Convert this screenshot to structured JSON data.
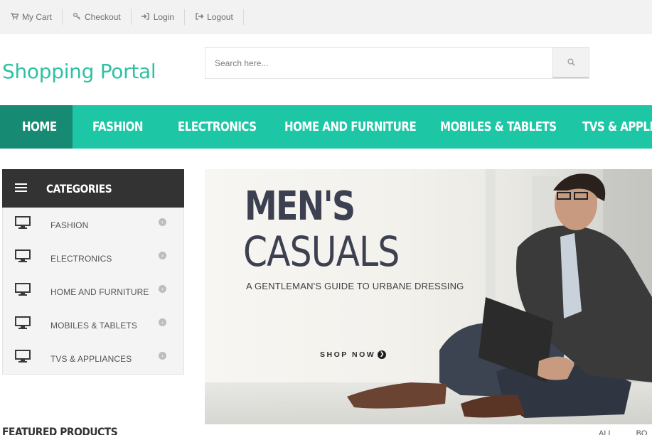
{
  "topbar": {
    "links": [
      {
        "label": "My Cart",
        "icon": "cart-icon"
      },
      {
        "label": "Checkout",
        "icon": "key-icon"
      },
      {
        "label": "Login",
        "icon": "sign-in-icon"
      },
      {
        "label": "Logout",
        "icon": "sign-out-icon"
      }
    ]
  },
  "header": {
    "logo": "Shopping Portal",
    "search_placeholder": "Search here..."
  },
  "nav": {
    "items": [
      {
        "label": "HOME",
        "active": true
      },
      {
        "label": "FASHION"
      },
      {
        "label": "ELECTRONICS"
      },
      {
        "label": "HOME AND FURNITURE"
      },
      {
        "label": "MOBILES & TABLETS"
      },
      {
        "label": "TVS & APPLIANCES"
      }
    ]
  },
  "categories": {
    "title": "CATEGORIES",
    "items": [
      {
        "label": "FASHION"
      },
      {
        "label": "ELECTRONICS"
      },
      {
        "label": "HOME AND FURNITURE"
      },
      {
        "label": "MOBILES & TABLETS"
      },
      {
        "label": "TVS & APPLIANCES"
      }
    ]
  },
  "banner": {
    "line1": "MEN'S",
    "line2": "CASUALS",
    "subtitle": "A GENTLEMAN'S GUIDE TO URBANE DRESSING",
    "cta": "SHOP NOW"
  },
  "featured": {
    "title": "FEATURED PRODUCTS",
    "tabs": [
      "ALL",
      "BO"
    ]
  },
  "colors": {
    "accent": "#1dc6a4",
    "accent_dark": "#178a73",
    "logo": "#2fc1a2",
    "category_header": "#333333"
  }
}
